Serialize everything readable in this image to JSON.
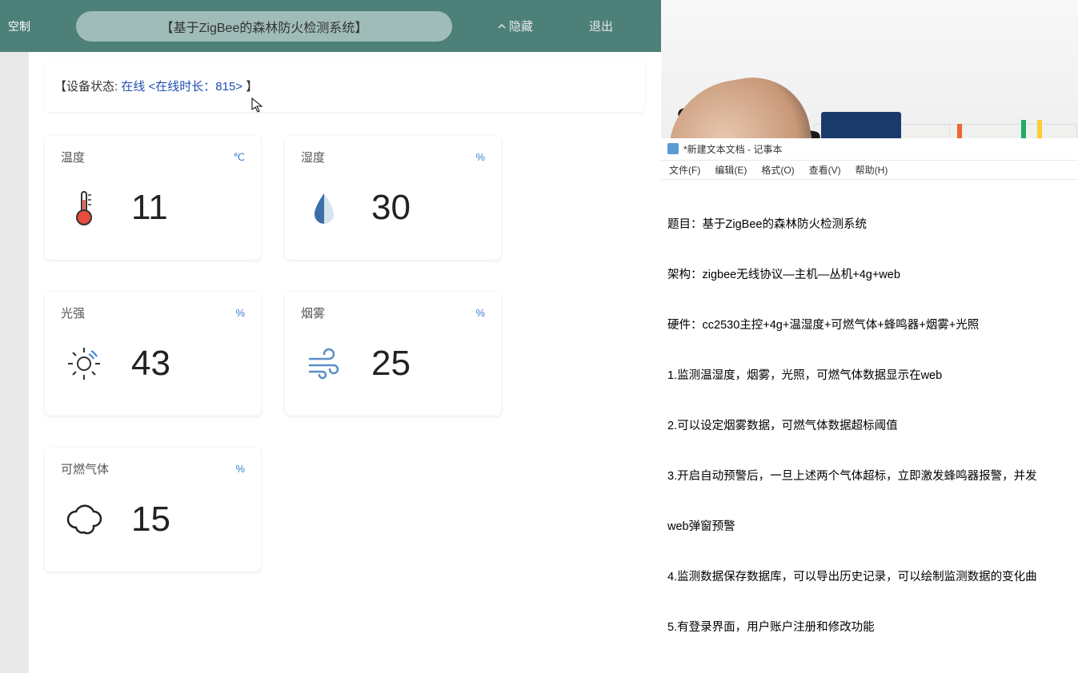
{
  "topbar": {
    "left_truncated": "空制",
    "title": "【基于ZigBee的森林防火检测系统】",
    "hide_label": "隐藏",
    "exit_label": "退出"
  },
  "status": {
    "prefix": "【设备状态:",
    "online_text": "在线 <在线时长：815>",
    "suffix": "】"
  },
  "sensors": {
    "temperature": {
      "label": "温度",
      "unit": "℃",
      "value": "11"
    },
    "humidity": {
      "label": "湿度",
      "unit": "%",
      "value": "30"
    },
    "light": {
      "label": "光强",
      "unit": "%",
      "value": "43"
    },
    "smoke": {
      "label": "烟雾",
      "unit": "%",
      "value": "25"
    },
    "gas": {
      "label": "可燃气体",
      "unit": "%",
      "value": "15"
    }
  },
  "notepad": {
    "window_title": "*新建文本文档 - 记事本",
    "menu": {
      "file": "文件(F)",
      "edit": "编辑(E)",
      "format": "格式(O)",
      "view": "查看(V)",
      "help": "帮助(H)"
    },
    "lines": [
      "题目：基于ZigBee的森林防火检测系统",
      "架构：zigbee无线协议—主机—丛机+4g+web",
      "硬件：cc2530主控+4g+温湿度+可燃气体+蜂鸣器+烟雾+光照",
      "1.监测温湿度，烟雾，光照，可燃气体数据显示在web",
      "2.可以设定烟雾数据，可燃气体数据超标阈值",
      "3.开启自动预警后，一旦上述两个气体超标，立即激发蜂鸣器报警，并发",
      "web弹窗预警",
      "4.监测数据保存数据库，可以导出历史记录，可以绘制监测数据的变化曲",
      "5.有登录界面，用户账户注册和修改功能"
    ]
  }
}
